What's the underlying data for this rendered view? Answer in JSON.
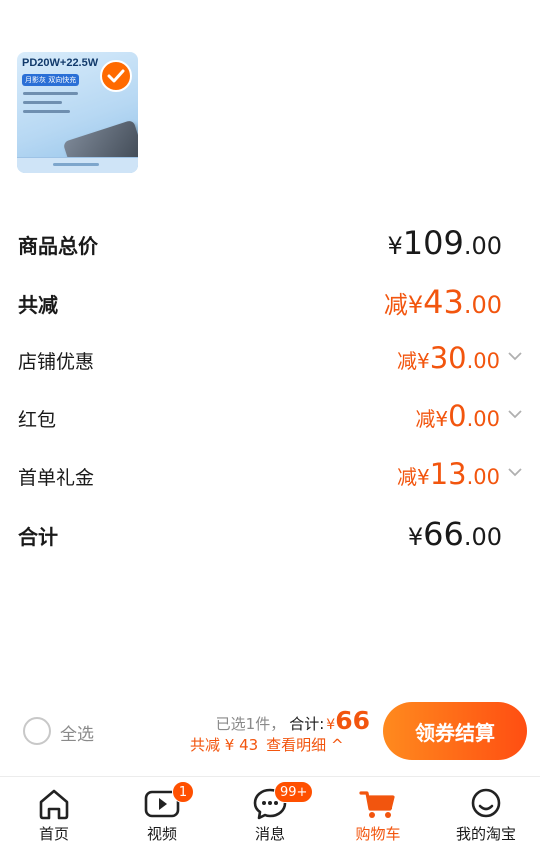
{
  "product": {
    "thumbnail_title": "PD20W+22.5W",
    "thumbnail_chip": "月影灰  双向快充",
    "selected": true
  },
  "summary": [
    {
      "label": "商品总价",
      "prefix": "¥",
      "integer": "109",
      "decimals": ".00",
      "style": "dark",
      "bold": true,
      "chevron": false
    },
    {
      "label": "共减",
      "prefix": "减¥",
      "integer": "43",
      "decimals": ".00",
      "style": "orange",
      "bold": true,
      "chevron": false
    },
    {
      "label": "店铺优惠",
      "prefix": "减¥",
      "integer": "30",
      "decimals": ".00",
      "style": "orange",
      "bold": false,
      "chevron": true
    },
    {
      "label": "红包",
      "prefix": "减¥",
      "integer": "0",
      "decimals": ".00",
      "style": "orange",
      "bold": false,
      "chevron": true
    },
    {
      "label": "首单礼金",
      "prefix": "减¥",
      "integer": "13",
      "decimals": ".00",
      "style": "orange",
      "bold": false,
      "chevron": true
    },
    {
      "label": "合计",
      "prefix": "¥",
      "integer": "66",
      "decimals": ".00",
      "style": "dark",
      "bold": true,
      "chevron": false
    }
  ],
  "checkout": {
    "select_all_label": "全选",
    "selected_count": "已选1件，",
    "total_label": "合计:",
    "total_currency": "¥",
    "total_value": "66",
    "discount_text": "共减 ¥ 43",
    "details_link": "查看明细 ^",
    "button_label": "领券结算"
  },
  "tabs": [
    {
      "label": "首页",
      "icon": "home-icon",
      "badge": ""
    },
    {
      "label": "视频",
      "icon": "video-icon",
      "badge": "1"
    },
    {
      "label": "消息",
      "icon": "message-icon",
      "badge": "99+"
    },
    {
      "label": "购物车",
      "icon": "cart-icon",
      "badge": "",
      "active": true
    },
    {
      "label": "我的淘宝",
      "icon": "profile-icon",
      "badge": ""
    }
  ],
  "colors": {
    "accent": "#f2550e",
    "button_start": "#ff8a1e",
    "button_end": "#ff4e12",
    "text": "#1a1a1a",
    "muted": "#8a8a8a"
  }
}
